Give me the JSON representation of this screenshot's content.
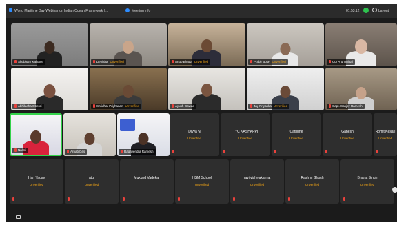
{
  "topbar": {
    "title": "World Maritime Day Webinar on Indian Ocean Framework |...",
    "meeting_info": "Meeting info",
    "clock": "01:53:12",
    "layout_label": "Layout"
  },
  "unverified_label": "Unverified",
  "video_tiles": [
    {
      "name": "Shubham Kalyane"
    },
    {
      "name": "Denisha",
      "unverified": true
    },
    {
      "name": "Anup Bhatta",
      "unverified": true
    },
    {
      "name": "Prabir Bose",
      "unverified": true
    },
    {
      "name": "Cdr Arun Mittal"
    },
    {
      "name": "Abhilasha Oberoi"
    },
    {
      "name": "Shridhar Priyhanan",
      "unverified": true
    },
    {
      "name": "Ayush Gawad"
    },
    {
      "name": "Jay Priyanka",
      "unverified": true
    },
    {
      "name": "Capt. Sanjay Ramesh"
    },
    {
      "name": "Nalini"
    },
    {
      "name": "Arnab Das"
    },
    {
      "name": "Ragavendra Ramesh"
    }
  ],
  "name_tiles": [
    {
      "name": "Divya N",
      "unverified": true
    },
    {
      "name": "TYC KASHAPPI",
      "unverified": true
    },
    {
      "name": "Cathrine",
      "unverified": true
    },
    {
      "name": "Ganesh",
      "unverified": true
    },
    {
      "name": "Romit Kesari",
      "unverified": true
    },
    {
      "name": "Hari Yadav",
      "unverified": true
    },
    {
      "name": "atul",
      "unverified": true
    },
    {
      "name": "Mukund Vadekar",
      "unverified": false
    },
    {
      "name": "HSM School",
      "unverified": true
    },
    {
      "name": "ravi vishwakarma",
      "unverified": true
    },
    {
      "name": "Rashmi Ghosh",
      "unverified": true
    },
    {
      "name": "Bharat Singh",
      "unverified": true
    }
  ]
}
